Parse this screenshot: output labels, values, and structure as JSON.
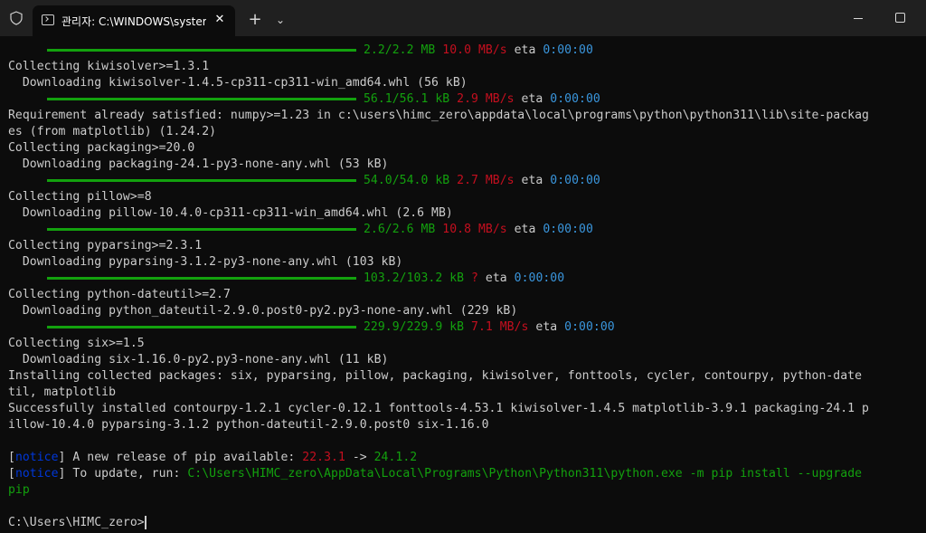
{
  "titlebar": {
    "tab_title": "관리자: C:\\WINDOWS\\syster",
    "tab_close": "✕",
    "new_tab": "+",
    "dropdown": "⌄"
  },
  "terminal": {
    "progress1": {
      "size": "2.2/2.2 MB",
      "speed": "10.0 MB/s",
      "eta_label": "eta",
      "eta": "0:00:00"
    },
    "l_collect_kiwi": "Collecting kiwisolver>=1.3.1",
    "l_dl_kiwi": "  Downloading kiwisolver-1.4.5-cp311-cp311-win_amd64.whl (56 kB)",
    "progress2": {
      "size": "56.1/56.1 kB",
      "speed": "2.9 MB/s",
      "eta_label": "eta",
      "eta": "0:00:00"
    },
    "l_req_numpy": "Requirement already satisfied: numpy>=1.23 in c:\\users\\himc_zero\\appdata\\local\\programs\\python\\python311\\lib\\site-packag",
    "l_req_numpy2": "es (from matplotlib) (1.24.2)",
    "l_collect_packaging": "Collecting packaging>=20.0",
    "l_dl_packaging": "  Downloading packaging-24.1-py3-none-any.whl (53 kB)",
    "progress3": {
      "size": "54.0/54.0 kB",
      "speed": "2.7 MB/s",
      "eta_label": "eta",
      "eta": "0:00:00"
    },
    "l_collect_pillow": "Collecting pillow>=8",
    "l_dl_pillow": "  Downloading pillow-10.4.0-cp311-cp311-win_amd64.whl (2.6 MB)",
    "progress4": {
      "size": "2.6/2.6 MB",
      "speed": "10.8 MB/s",
      "eta_label": "eta",
      "eta": "0:00:00"
    },
    "l_collect_pyparsing": "Collecting pyparsing>=2.3.1",
    "l_dl_pyparsing": "  Downloading pyparsing-3.1.2-py3-none-any.whl (103 kB)",
    "progress5": {
      "size": "103.2/103.2 kB",
      "speed": "?",
      "eta_label": "eta",
      "eta": "0:00:00"
    },
    "l_collect_dateutil": "Collecting python-dateutil>=2.7",
    "l_dl_dateutil": "  Downloading python_dateutil-2.9.0.post0-py2.py3-none-any.whl (229 kB)",
    "progress6": {
      "size": "229.9/229.9 kB",
      "speed": "7.1 MB/s",
      "eta_label": "eta",
      "eta": "0:00:00"
    },
    "l_collect_six": "Collecting six>=1.5",
    "l_dl_six": "  Downloading six-1.16.0-py2.py3-none-any.whl (11 kB)",
    "l_installing": "Installing collected packages: six, pyparsing, pillow, packaging, kiwisolver, fonttools, cycler, contourpy, python-date",
    "l_installing2": "til, matplotlib",
    "l_success": "Successfully installed contourpy-1.2.1 cycler-0.12.1 fonttools-4.53.1 kiwisolver-1.4.5 matplotlib-3.9.1 packaging-24.1 p",
    "l_success2": "illow-10.4.0 pyparsing-3.1.2 python-dateutil-2.9.0.post0 six-1.16.0",
    "notice1": {
      "open": "[",
      "tag": "notice",
      "close": "]",
      "text": " A new release of pip available: ",
      "old": "22.3.1",
      "arrow": " -> ",
      "new": "24.1.2"
    },
    "notice2": {
      "open": "[",
      "tag": "notice",
      "close": "]",
      "text": " To update, run: ",
      "cmd": "C:\\Users\\HIMC_zero\\AppData\\Local\\Programs\\Python\\Python311\\python.exe -m pip install --upgrade"
    },
    "notice2_wrap": "pip",
    "prompt": "C:\\Users\\HIMC_zero>"
  },
  "colors": {
    "background": "#0c0c0c",
    "titlebar": "#202020",
    "text": "#cccccc",
    "green": "#13a10e",
    "red": "#c50f1f",
    "blue": "#3a96dd",
    "notice": "#0037da"
  }
}
